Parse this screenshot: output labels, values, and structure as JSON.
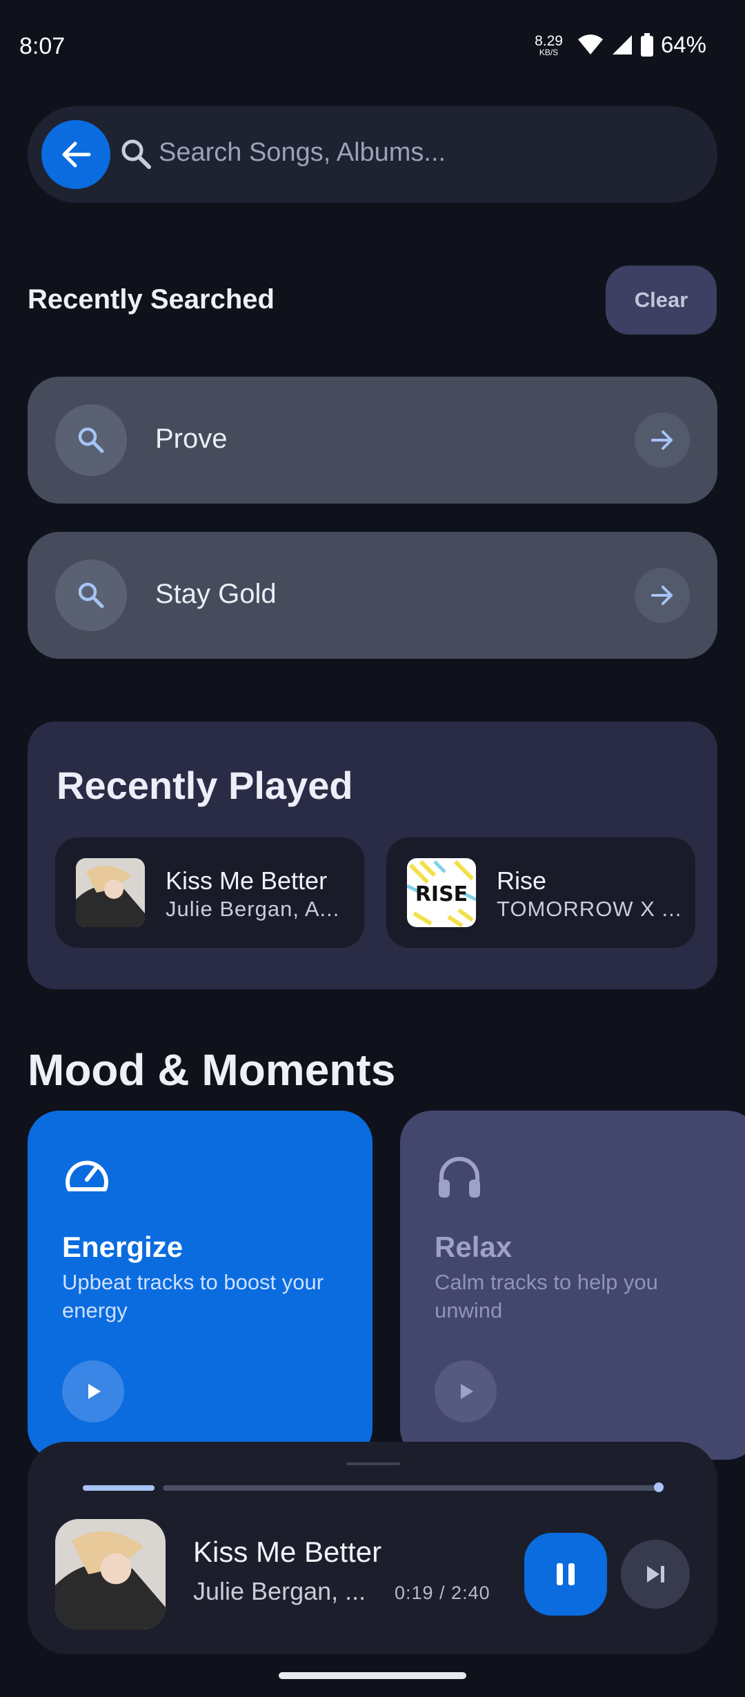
{
  "status": {
    "time": "8:07",
    "net_speed": "8.29",
    "net_unit": "KB/S",
    "battery": "64%"
  },
  "search": {
    "placeholder": "Search Songs, Albums..."
  },
  "recently_searched": {
    "title": "Recently Searched",
    "clear_label": "Clear",
    "items": [
      {
        "label": "Prove"
      },
      {
        "label": "Stay Gold"
      }
    ]
  },
  "recently_played": {
    "title": "Recently Played",
    "items": [
      {
        "title": "Kiss Me Better",
        "artist": "Julie Bergan, A..."
      },
      {
        "title": "Rise",
        "artist": "TOMORROW X ...",
        "art_text": "RISE"
      }
    ]
  },
  "mood": {
    "title": "Mood & Moments",
    "cards": [
      {
        "name": "Energize",
        "desc": "Upbeat tracks to boost your energy",
        "icon": "speedometer-icon"
      },
      {
        "name": "Relax",
        "desc": "Calm tracks to help you unwind",
        "icon": "headphones-icon"
      }
    ]
  },
  "player": {
    "title": "Kiss Me Better",
    "artist": "Julie Bergan, ...",
    "time": "0:19 / 2:40",
    "progress": 0.12
  },
  "colors": {
    "accent": "#0a6cdf",
    "background": "#0f121b"
  }
}
